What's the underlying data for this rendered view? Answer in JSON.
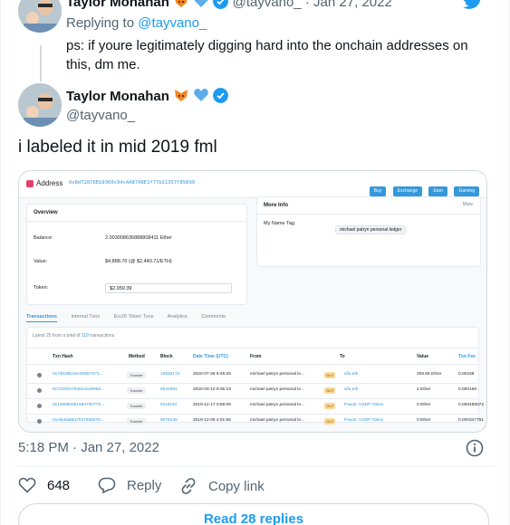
{
  "previous_tweet": {
    "author_name": "Taylor Monahan",
    "handle": "@tayvano_",
    "separator": "·",
    "date": "Jan 27, 2022",
    "replying_prefix": "Replying to",
    "replying_handle": "@tayvano_",
    "text": "ps: if youre legitimately digging hard into the onchain addresses on this, dm me."
  },
  "tweet": {
    "author_name": "Taylor Monahan",
    "handle": "@tayvano_",
    "text": "i labeled it in mid 2019 fml",
    "timestamp": "5:18 PM · Jan 27, 2022"
  },
  "embedded_screenshot": {
    "page_title": "Address",
    "address": "0x8d72876Eb9360c94c4A8748E1f77b21357f85899",
    "header_buttons": [
      "Buy",
      "Exchange",
      "Earn",
      "Gaming"
    ],
    "overview": {
      "title": "Overview",
      "balance_label": "Balance:",
      "balance_value": "2.003008636888808411 Ether",
      "value_label": "Value:",
      "value_value": "$4,888.76 (@ $2,440.71/ETH)",
      "token_label": "Token:",
      "token_value": "$2,050.39"
    },
    "more_info": {
      "title": "More Info",
      "more_label": "More",
      "name_tag_label": "My Name Tag:",
      "name_tag_value": "michael patryn personal ledger"
    },
    "tabs": [
      "Transactions",
      "Internal Txns",
      "Erc20 Token Txns",
      "Analytics",
      "Comments"
    ],
    "summary_prefix": "Latest 25 from a total of",
    "summary_count": "119",
    "summary_suffix": "transactions",
    "columns": [
      "Txn Hash",
      "Method",
      "Block",
      "Date Time (UTC)",
      "From",
      "To",
      "Value",
      "Txn Fee"
    ],
    "rows": [
      {
        "hash": "0x74b28b44e1f60b7471...",
        "method": "Transfer",
        "block": "10546173",
        "date": "2020-07-28 5:46:25",
        "from": "michael patryn personal le...",
        "dir": "OUT",
        "to": "sifu.eth",
        "value": "206.65 Ether",
        "fee": "0.00168"
      },
      {
        "hash": "0x722004754824a4995d...",
        "method": "Transfer",
        "block": "8642981",
        "date": "2020-03-10 9:35:19",
        "from": "michael patryn personal le...",
        "dir": "OUT",
        "to": "sifu.eth",
        "value": "2 Ether",
        "fee": "0.000168"
      },
      {
        "hash": "0x1289834b1584760779...",
        "method": "Transfer",
        "block": "9118184",
        "date": "2019-12-17 0:59:06",
        "from": "michael patryn personal le...",
        "dir": "OUT",
        "to": "Paxos: USDP Token",
        "value": "0 Ether",
        "fee": "0.000495072"
      },
      {
        "hash": "0xc9e8a66a7027556b78...",
        "method": "Transfer",
        "block": "9075448",
        "date": "2019-12-09 4:01:56",
        "from": "michael patryn personal le...",
        "dir": "OUT",
        "to": "Paxos: USDP Token",
        "value": "0 Ether",
        "fee": "0.000347751"
      }
    ]
  },
  "actions": {
    "like_count": "648",
    "reply_label": "Reply",
    "copy_label": "Copy link"
  },
  "read_replies_label": "Read 28 replies",
  "colors": {
    "twitter_blue": "#1d9bf0",
    "etherscan_blue": "#3498db",
    "text_dark": "#0f1419",
    "text_gray": "#536471"
  }
}
